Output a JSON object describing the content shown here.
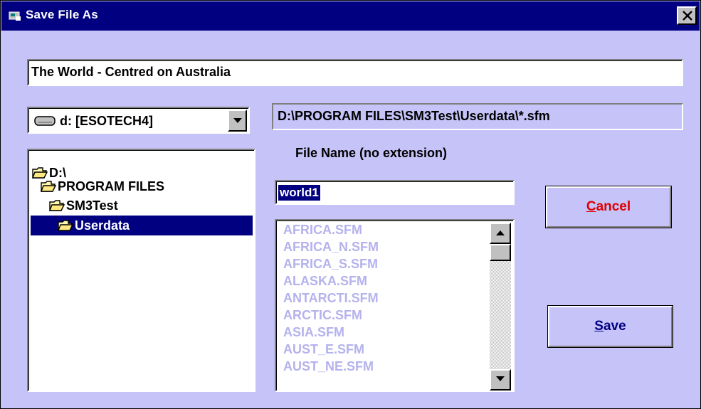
{
  "window": {
    "title": "Save File As",
    "close_label": "X"
  },
  "description": {
    "value": "The World - Centred on Australia"
  },
  "drive": {
    "selected": "d: [ESOTECH4]"
  },
  "path": {
    "value": "D:\\PROGRAM FILES\\SM3Test\\Userdata\\*.sfm"
  },
  "tree": {
    "items": [
      {
        "label": "D:\\"
      },
      {
        "label": "PROGRAM FILES"
      },
      {
        "label": "SM3Test"
      },
      {
        "label": "Userdata",
        "selected": true
      }
    ]
  },
  "filename": {
    "label": "File Name (no extension)",
    "value": "world1"
  },
  "files": {
    "items": [
      "AFRICA.SFM",
      "AFRICA_N.SFM",
      "AFRICA_S.SFM",
      "ALASKA.SFM",
      "ANTARCTI.SFM",
      "ARCTIC.SFM",
      "ASIA.SFM",
      "AUST_E.SFM",
      "AUST_NE.SFM"
    ]
  },
  "buttons": {
    "cancel_first": "C",
    "cancel_rest": "ancel",
    "save_first": "S",
    "save_rest": "ave"
  },
  "colors": {
    "titlebar": "#000080",
    "dialog_bg": "#c6c3f8",
    "disabled_text": "#b5b2ec",
    "cancel_text": "#e00000"
  }
}
